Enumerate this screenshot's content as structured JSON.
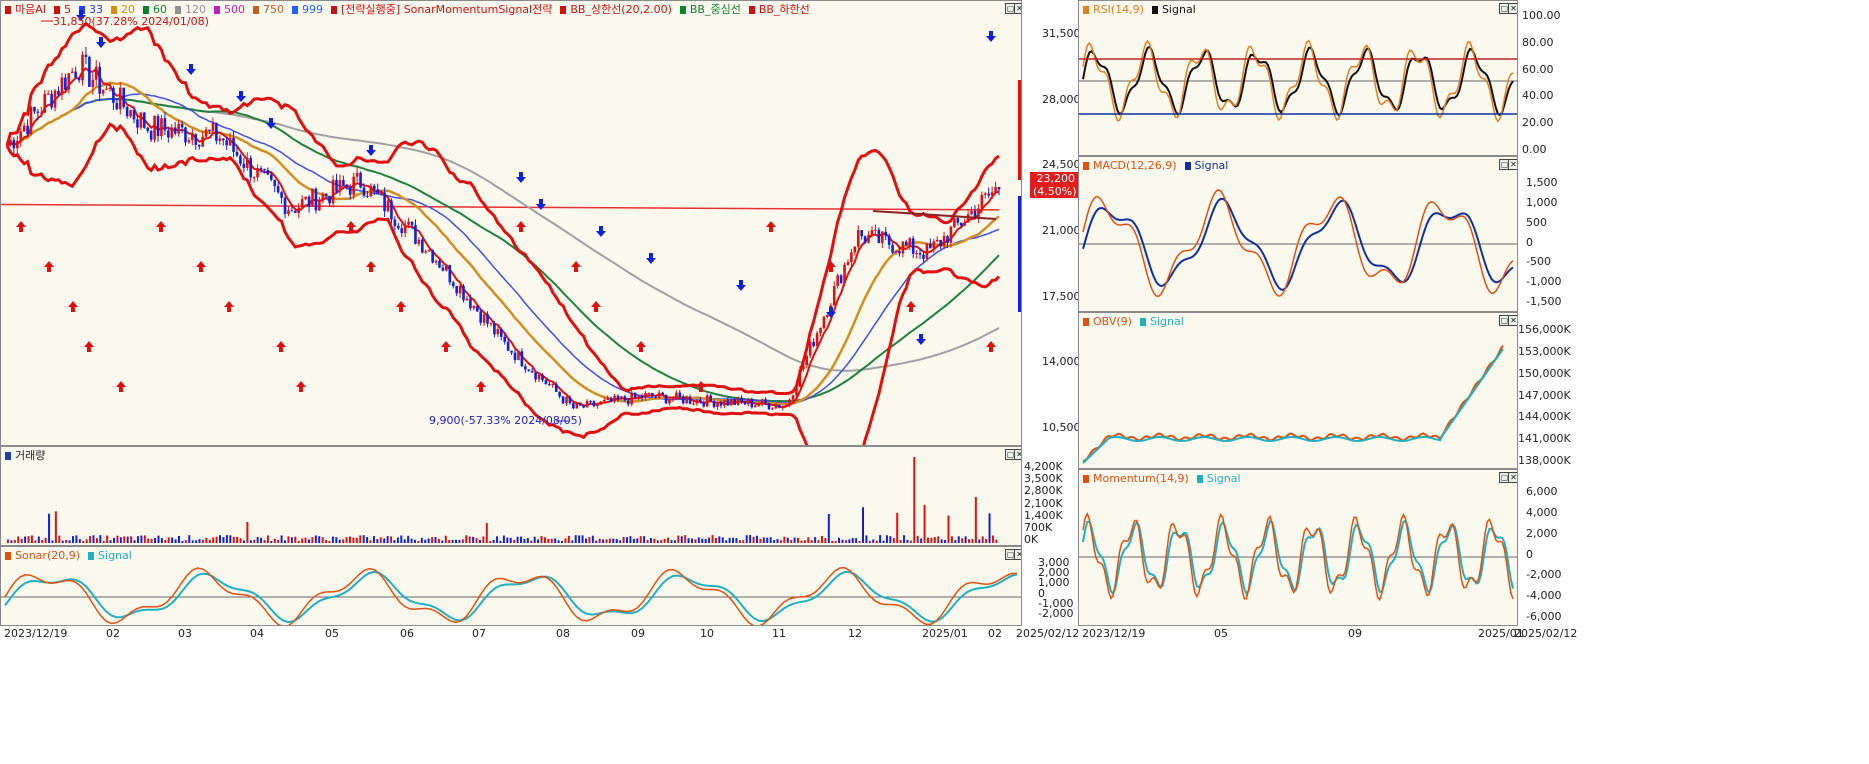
{
  "left": {
    "main_legend": [
      {
        "label": "마음AI",
        "color": "#d01010"
      },
      {
        "label": "5",
        "color": "#d01010"
      },
      {
        "label": "33",
        "color": "#2040ff"
      },
      {
        "label": "20",
        "color": "#d09010"
      },
      {
        "label": "60",
        "color": "#108030"
      },
      {
        "label": "120",
        "color": "#909090"
      },
      {
        "label": "500",
        "color": "#c020c0"
      },
      {
        "label": "750",
        "color": "#c06020"
      },
      {
        "label": "999",
        "color": "#2060ff"
      },
      {
        "label": "[전략실행중] SonarMomentumSignal전략",
        "color": "#d01010"
      },
      {
        "label": "BB_상한선(20,2.00)",
        "color": "#d01010"
      },
      {
        "label": "BB_중심선",
        "color": "#108030"
      },
      {
        "label": "BB_하한선",
        "color": "#d01010"
      }
    ],
    "price_axis": [
      "31,500",
      "28,000",
      "24,500",
      "21,000",
      "17,500",
      "14,000",
      "10,500"
    ],
    "high_annotation": "31,850(37.28% 2024/01/08)",
    "low_annotation": "9,900(-57.33% 2024/08/05)",
    "current_price": "23,200",
    "current_change": "4.50%",
    "volume_legend": "거래량",
    "volume_axis": [
      "4,200K",
      "3,500K",
      "2,800K",
      "2,100K",
      "1,400K",
      "700K",
      "0K"
    ],
    "sonar_legend": [
      "Sonar(20,9)",
      "Signal"
    ],
    "sonar_axis": [
      "3,000",
      "2,000",
      "1,000",
      "0",
      "-1,000",
      "-2,000"
    ],
    "x_axis": [
      "2023/12/19",
      "02",
      "03",
      "04",
      "05",
      "06",
      "07",
      "08",
      "09",
      "10",
      "11",
      "12",
      "2025/01",
      "02",
      "2025/02/12"
    ]
  },
  "right": {
    "rsi_legend": [
      "RSI(14,9)",
      "Signal"
    ],
    "rsi_axis": [
      "100.00",
      "80.00",
      "60.00",
      "40.00",
      "20.00",
      "0.00"
    ],
    "macd_legend": [
      "MACD(12,26,9)",
      "Signal"
    ],
    "macd_axis": [
      "1,500",
      "1,000",
      "500",
      "0",
      "-500",
      "-1,000",
      "-1,500"
    ],
    "obv_legend": [
      "OBV(9)",
      "Signal"
    ],
    "obv_axis": [
      "156,000K",
      "153,000K",
      "150,000K",
      "147,000K",
      "144,000K",
      "141,000K",
      "138,000K"
    ],
    "mom_legend": [
      "Momentum(14,9)",
      "Signal"
    ],
    "mom_axis": [
      "6,000",
      "4,000",
      "2,000",
      "0",
      "-2,000",
      "-4,000",
      "-6,000"
    ],
    "x_axis": [
      "2023/12/19",
      "05",
      "09",
      "2025/01",
      "2025/02/12"
    ]
  },
  "chart_data": {
    "type": "line",
    "title": "마음AI",
    "x": [
      "2023/12",
      "2024/01",
      "2024/02",
      "2024/03",
      "2024/04",
      "2024/05",
      "2024/06",
      "2024/07",
      "2024/08",
      "2024/09",
      "2024/10",
      "2024/11",
      "2024/12",
      "2025/01",
      "2025/02"
    ],
    "series": [
      {
        "name": "마음AI",
        "values": [
          25500,
          30000,
          26500,
          26000,
          22000,
          23500,
          19500,
          14500,
          10800,
          11500,
          11200,
          11000,
          20500,
          19500,
          23200
        ]
      }
    ],
    "ylim": [
      9000,
      33000
    ],
    "annotations": [
      "31,850(37.28% 2024/01/08)",
      "9,900(-57.33% 2024/08/05)"
    ]
  }
}
